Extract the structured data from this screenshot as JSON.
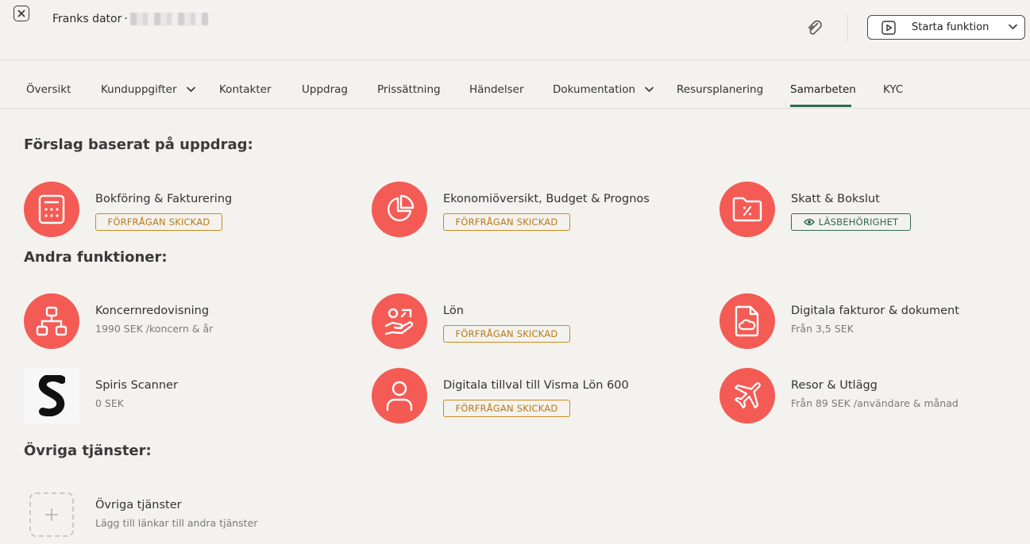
{
  "header": {
    "title": "Franks dator",
    "title_separator": "·",
    "start_button_label": "Starta funktion"
  },
  "tabs": [
    {
      "label": "Översikt"
    },
    {
      "label": "Kunduppgifter"
    },
    {
      "label": "Kontakter"
    },
    {
      "label": "Uppdrag"
    },
    {
      "label": "Prissättning"
    },
    {
      "label": "Händelser"
    },
    {
      "label": "Dokumentation"
    },
    {
      "label": "Resursplanering"
    },
    {
      "label": "Samarbeten"
    },
    {
      "label": "KYC"
    }
  ],
  "active_tab": "Samarbeten",
  "sections": {
    "suggested": {
      "title": "Förslag baserat på uppdrag:",
      "items": [
        {
          "name": "Bokföring & Fakturering",
          "badge": "FÖRFRÅGAN SKICKAD",
          "icon": "calculator-icon"
        },
        {
          "name": "Ekonomiöversikt, Budget & Prognos",
          "badge": "FÖRFRÅGAN SKICKAD",
          "icon": "pie-chart-icon"
        },
        {
          "name": "Skatt & Bokslut",
          "badge": "LÄSBEHÖRIGHET",
          "icon": "folder-percent-icon"
        }
      ]
    },
    "other_functions": {
      "title": "Andra funktioner:",
      "items": [
        {
          "name": "Koncernredovisning",
          "sub": "1990 SEK /koncern & år",
          "icon": "hierarchy-icon"
        },
        {
          "name": "Lön",
          "badge": "FÖRFRÅGAN SKICKAD",
          "icon": "hand-money-icon"
        },
        {
          "name": "Digitala fakturor & dokument",
          "sub": "Från 3,5 SEK",
          "icon": "document-cloud-icon"
        },
        {
          "name": "Spiris Scanner",
          "sub": "0 SEK",
          "icon": "spiris-logo"
        },
        {
          "name": "Digitala tillval till Visma Lön 600",
          "badge": "FÖRFRÅGAN SKICKAD",
          "icon": "user-icon"
        },
        {
          "name": "Resor & Utlägg",
          "sub": "Från 89 SEK /användare & månad",
          "icon": "airplane-icon"
        }
      ]
    },
    "other_services": {
      "title": "Övriga tjänster:",
      "items": [
        {
          "name": "Övriga tjänster",
          "sub": "Lägg till länkar till andra tjänster",
          "icon": "plus-icon"
        }
      ]
    }
  },
  "colors": {
    "accent_circle": "#f45b55",
    "badge_pending": "#c98a1c",
    "badge_read": "#2d6a4f",
    "active_tab_underline": "#2d6a4f",
    "background": "#f4f2ee"
  }
}
